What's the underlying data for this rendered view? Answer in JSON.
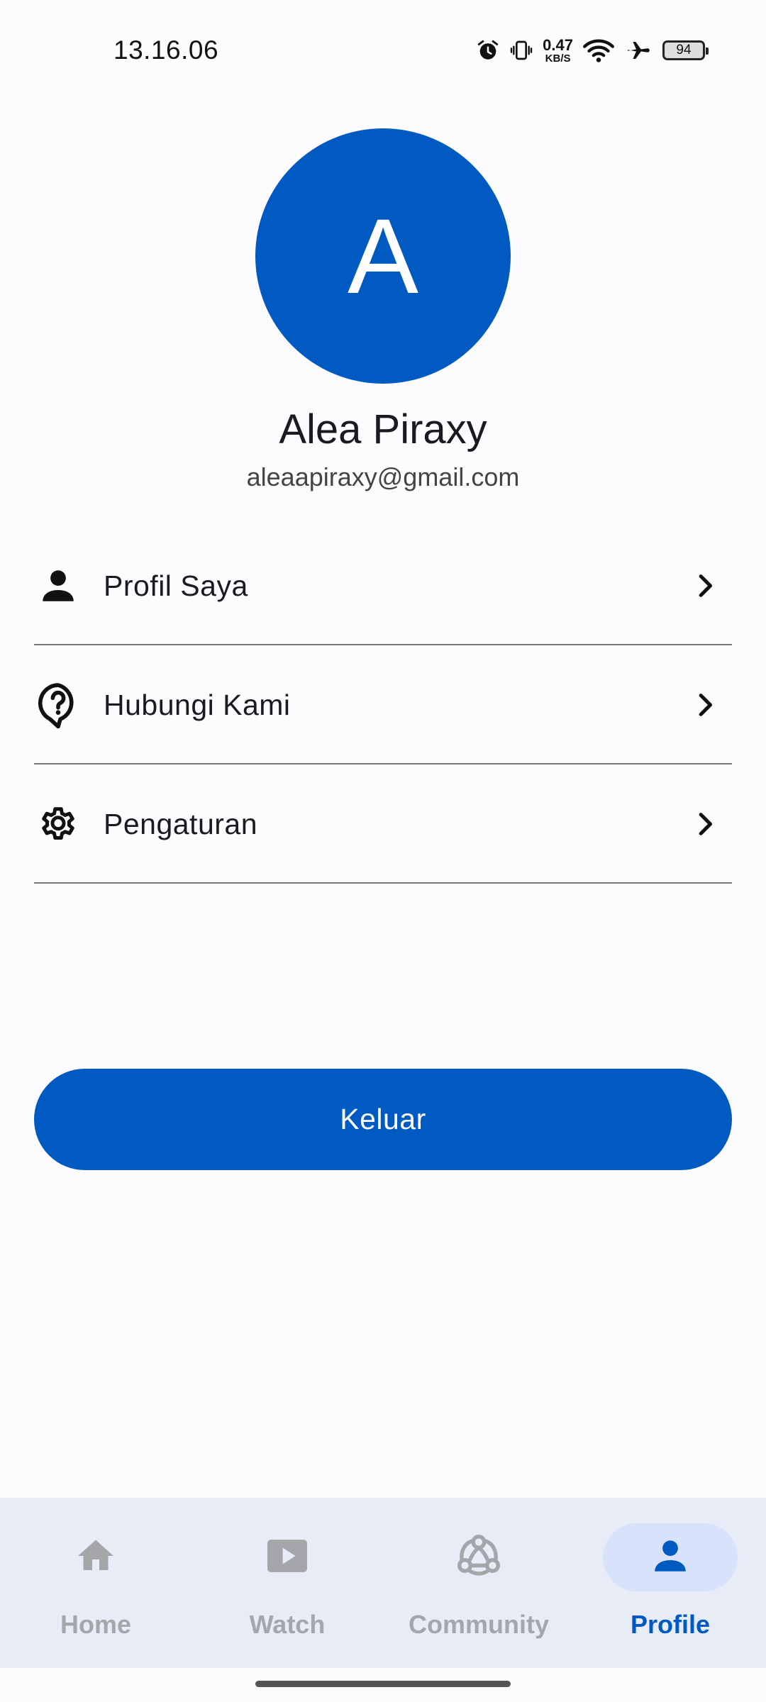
{
  "status_bar": {
    "time": "13.16.06",
    "net_speed_value": "0.47",
    "net_speed_unit": "KB/S",
    "battery": "94",
    "icons": [
      "alarm-icon",
      "vibrate-icon",
      "wifi-icon",
      "airplane-icon",
      "battery-icon"
    ]
  },
  "profile": {
    "avatar_letter": "A",
    "name": "Alea Piraxy",
    "email": "aleaapiraxy@gmail.com",
    "avatar_color": "#005ac1"
  },
  "menu": {
    "items": [
      {
        "label": "Profil Saya",
        "icon": "person-icon"
      },
      {
        "label": "Hubungi Kami",
        "icon": "help-chat-icon"
      },
      {
        "label": "Pengaturan",
        "icon": "gear-icon"
      }
    ]
  },
  "logout": {
    "label": "Keluar"
  },
  "bottom_nav": {
    "items": [
      {
        "label": "Home",
        "icon": "home-icon",
        "active": false
      },
      {
        "label": "Watch",
        "icon": "play-icon",
        "active": false
      },
      {
        "label": "Community",
        "icon": "community-icon",
        "active": false
      },
      {
        "label": "Profile",
        "icon": "person-icon",
        "active": true
      }
    ],
    "active_color": "#005ac1",
    "inactive_color": "#a4a6aa"
  }
}
